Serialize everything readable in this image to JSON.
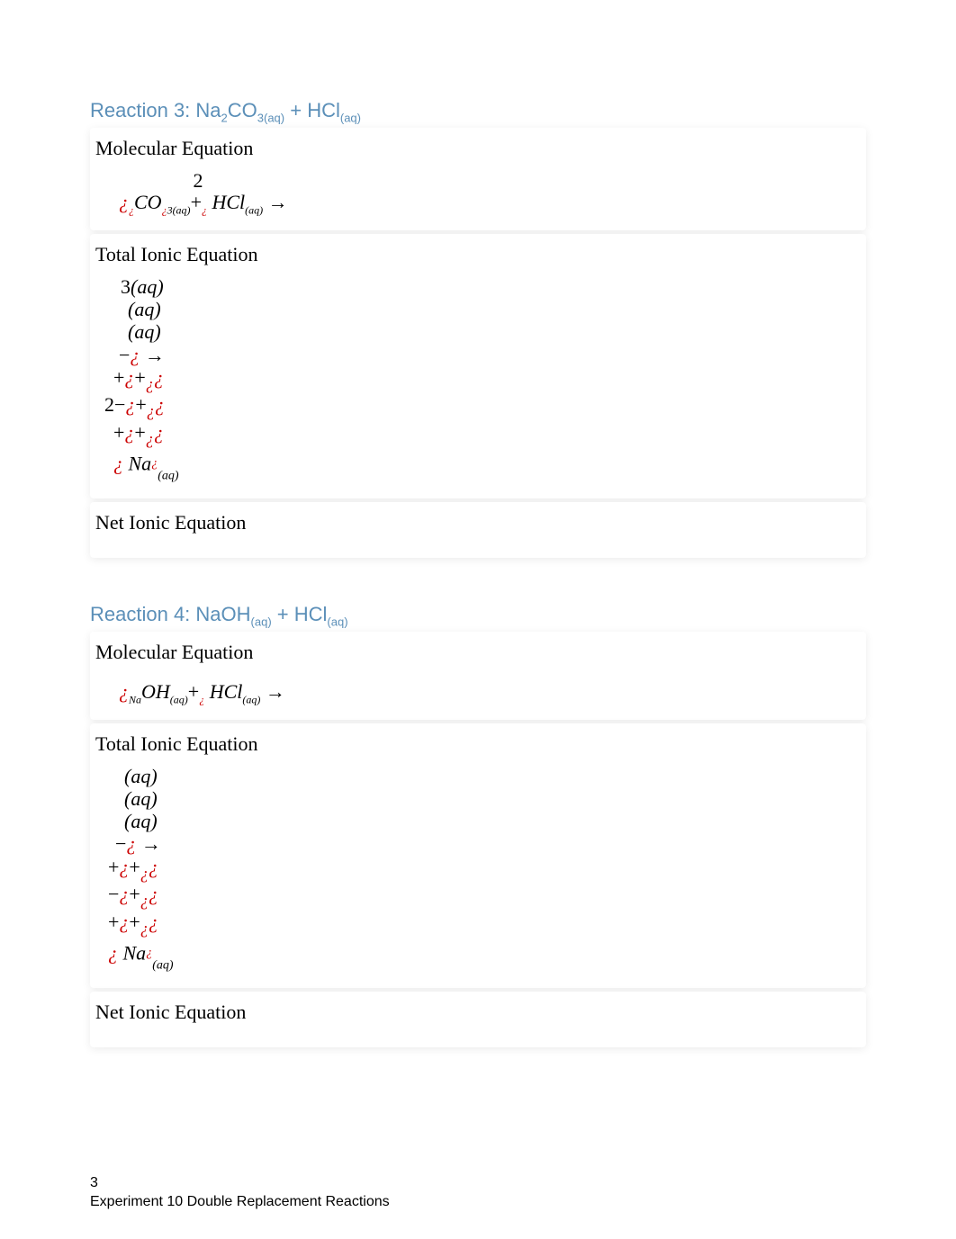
{
  "reaction3": {
    "heading_prefix": "Reaction 3: Na",
    "heading_sub1": "2",
    "heading_mid": "CO",
    "heading_sub2": "3(aq)",
    "heading_plus": " + HCl",
    "heading_sub3": "(aq)",
    "molecular_label": "Molecular Equation",
    "total_label": "Total Ionic Equation",
    "net_label": "Net Ionic Equation",
    "eq1_top2": "2",
    "eq1_l1": "¿",
    "eq1_l2": "¿",
    "eq1_CO": "CO",
    "eq1_l3": "¿",
    "eq1_sub3aq": "3(aq)",
    "eq1_plus": "+",
    "eq1_l4": "¿",
    "eq1_HCl": " HCl",
    "eq1_subaq": "(aq)",
    "eq1_arrow": " →",
    "ti_r1": "3",
    "ti_r1b": "(aq)",
    "ti_r2": "(aq)",
    "ti_r3": "(aq)",
    "ti_r4a": "−",
    "ti_r4b": "¿",
    "ti_r4c": " →",
    "ti_r5a": "+",
    "ti_r5b": "¿",
    "ti_r5c": "+",
    "ti_r5d": "¿",
    "ti_r5e": "¿",
    "ti_r6a": "2−",
    "ti_r6b": "¿",
    "ti_r6c": "+",
    "ti_r6d": "¿",
    "ti_r6e": "¿",
    "ti_r7a": "+",
    "ti_r7b": "¿",
    "ti_r7c": "+",
    "ti_r7d": "¿",
    "ti_r7e": "¿",
    "ti_r8a": "¿",
    "ti_r8b": " Na",
    "ti_r8c": "¿",
    "ti_r8d": "(aq)"
  },
  "reaction4": {
    "heading_prefix": "Reaction 4: NaOH",
    "heading_sub1": "(aq)",
    "heading_plus": " + HCl",
    "heading_sub2": "(aq)",
    "molecular_label": "Molecular Equation",
    "total_label": "Total Ionic Equation",
    "net_label": "Net Ionic Equation",
    "eq1_l1": "¿",
    "eq1_Na": "Na",
    "eq1_OH": "OH",
    "eq1_subaq1": "(aq)",
    "eq1_plus": "+",
    "eq1_l2": "¿",
    "eq1_HCl": " HCl",
    "eq1_subaq2": "(aq)",
    "eq1_arrow": " →",
    "ti_r1": "(aq)",
    "ti_r2": "(aq)",
    "ti_r3": "(aq)",
    "ti_r4a": "−",
    "ti_r4b": "¿",
    "ti_r4c": " →",
    "ti_r5a": "+",
    "ti_r5b": "¿",
    "ti_r5c": "+",
    "ti_r5d": "¿",
    "ti_r5e": "¿",
    "ti_r6a": "−",
    "ti_r6b": "¿",
    "ti_r6c": "+",
    "ti_r6d": "¿",
    "ti_r6e": "¿",
    "ti_r7a": "+",
    "ti_r7b": "¿",
    "ti_r7c": "+",
    "ti_r7d": "¿",
    "ti_r7e": "¿",
    "ti_r8a": "¿",
    "ti_r8b": " Na",
    "ti_r8c": "¿",
    "ti_r8d": "(aq)"
  },
  "footer": {
    "page": "3",
    "title": "Experiment 10 Double Replacement Reactions"
  }
}
